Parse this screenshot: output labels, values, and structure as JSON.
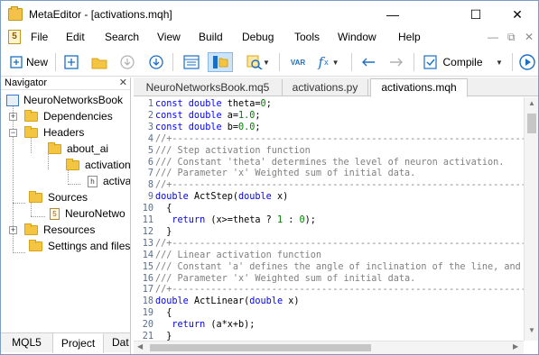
{
  "window": {
    "title": "MetaEditor - [activations.mqh]",
    "minimize_glyph": "—",
    "maximize_glyph": "☐",
    "close_glyph": "✕"
  },
  "menu": {
    "icon_text": "5",
    "items": [
      "File",
      "Edit",
      "Search",
      "View",
      "Build",
      "Debug",
      "Tools",
      "Window",
      "Help"
    ],
    "right_glyphs": [
      "—",
      "⧉",
      "✕"
    ]
  },
  "toolbar": {
    "new_label": "New",
    "compile_label": "Compile",
    "var_label": "VAR",
    "fx_label": "f",
    "icons": [
      "new-file-icon",
      "new-file-plus-icon",
      "open-folder-icon",
      "download-icon",
      "update-icon",
      "navigator-toggle-icon",
      "folder-toggle-icon",
      "zoom-icon",
      "var-icon",
      "fx-icon",
      "back-arrow-icon",
      "forward-arrow-icon",
      "compile-icon",
      "run-icon"
    ],
    "accent": "#1a6fc7"
  },
  "navigator": {
    "title": "Navigator",
    "close_glyph": "✕",
    "tree": [
      {
        "label": "NeuroNetworksBook",
        "kind": "project"
      },
      {
        "label": "Dependencies",
        "kind": "folder",
        "expander": "+"
      },
      {
        "label": "Headers",
        "kind": "folder",
        "expander": "−"
      },
      {
        "label": "about_ai",
        "kind": "folder"
      },
      {
        "label": "activation",
        "kind": "folder"
      },
      {
        "label": "activa",
        "kind": "file-h"
      },
      {
        "label": "Sources",
        "kind": "folder"
      },
      {
        "label": "NeuroNetwo",
        "kind": "file-5"
      },
      {
        "label": "Resources",
        "kind": "folder",
        "expander": "+"
      },
      {
        "label": "Settings and files",
        "kind": "folder"
      }
    ],
    "bottom_tabs": [
      "MQL5",
      "Project",
      "Dat"
    ],
    "active_bottom_tab": "Project"
  },
  "editor": {
    "tabs": [
      "NeuroNetworksBook.mq5",
      "activations.py",
      "activations.mqh"
    ],
    "active_tab": "activations.mqh",
    "lines": [
      {
        "n": "1",
        "parts": [
          {
            "c": "kw",
            "t": "const double "
          },
          {
            "c": "txt",
            "t": "theta="
          },
          {
            "c": "num",
            "t": "0"
          },
          {
            "c": "txt",
            "t": ";"
          }
        ]
      },
      {
        "n": "2",
        "parts": [
          {
            "c": "kw",
            "t": "const double "
          },
          {
            "c": "txt",
            "t": "a="
          },
          {
            "c": "num",
            "t": "1.0"
          },
          {
            "c": "txt",
            "t": ";"
          }
        ]
      },
      {
        "n": "3",
        "parts": [
          {
            "c": "kw",
            "t": "const double "
          },
          {
            "c": "txt",
            "t": "b="
          },
          {
            "c": "num",
            "t": "0.0"
          },
          {
            "c": "txt",
            "t": ";"
          }
        ]
      },
      {
        "n": "4",
        "parts": [
          {
            "c": "cm",
            "t": "//+----------------------------------------------------------------"
          }
        ]
      },
      {
        "n": "5",
        "parts": [
          {
            "c": "cm",
            "t": "/// Step activation function"
          }
        ]
      },
      {
        "n": "6",
        "parts": [
          {
            "c": "cm",
            "t": "/// Constant 'theta' determines the level of neuron activation."
          }
        ]
      },
      {
        "n": "7",
        "parts": [
          {
            "c": "cm",
            "t": "/// Parameter 'x' Weighted sum of initial data."
          }
        ]
      },
      {
        "n": "8",
        "parts": [
          {
            "c": "cm",
            "t": "//+----------------------------------------------------------------"
          }
        ]
      },
      {
        "n": "9",
        "parts": [
          {
            "c": "kw",
            "t": "double "
          },
          {
            "c": "txt",
            "t": "ActStep("
          },
          {
            "c": "kw",
            "t": "double "
          },
          {
            "c": "txt",
            "t": "x)"
          }
        ]
      },
      {
        "n": "10",
        "parts": [
          {
            "c": "txt",
            "t": "  {"
          }
        ]
      },
      {
        "n": "11",
        "parts": [
          {
            "c": "txt",
            "t": "   "
          },
          {
            "c": "kw",
            "t": "return "
          },
          {
            "c": "txt",
            "t": "(x>=theta ? "
          },
          {
            "c": "num",
            "t": "1"
          },
          {
            "c": "txt",
            "t": " : "
          },
          {
            "c": "num",
            "t": "0"
          },
          {
            "c": "txt",
            "t": ");"
          }
        ]
      },
      {
        "n": "12",
        "parts": [
          {
            "c": "txt",
            "t": "  }"
          }
        ]
      },
      {
        "n": "13",
        "parts": [
          {
            "c": "cm",
            "t": "//+----------------------------------------------------------------"
          }
        ]
      },
      {
        "n": "14",
        "parts": [
          {
            "c": "cm",
            "t": "/// Linear activation function"
          }
        ]
      },
      {
        "n": "15",
        "parts": [
          {
            "c": "cm",
            "t": "/// Constant 'a' defines the angle of inclination of the line, and '"
          }
        ]
      },
      {
        "n": "16",
        "parts": [
          {
            "c": "cm",
            "t": "/// Parameter 'x' Weighted sum of initial data."
          }
        ]
      },
      {
        "n": "17",
        "parts": [
          {
            "c": "cm",
            "t": "//+----------------------------------------------------------------"
          }
        ]
      },
      {
        "n": "18",
        "parts": [
          {
            "c": "kw",
            "t": "double "
          },
          {
            "c": "txt",
            "t": "ActLinear("
          },
          {
            "c": "kw",
            "t": "double "
          },
          {
            "c": "txt",
            "t": "x)"
          }
        ]
      },
      {
        "n": "19",
        "parts": [
          {
            "c": "txt",
            "t": "  {"
          }
        ]
      },
      {
        "n": "20",
        "parts": [
          {
            "c": "txt",
            "t": "   "
          },
          {
            "c": "kw",
            "t": "return "
          },
          {
            "c": "txt",
            "t": "(a*x+b);"
          }
        ]
      },
      {
        "n": "21",
        "parts": [
          {
            "c": "txt",
            "t": "  }"
          }
        ]
      }
    ]
  }
}
